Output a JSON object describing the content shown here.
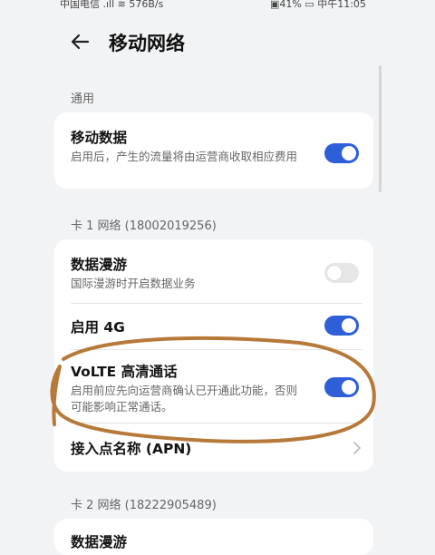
{
  "status_bar": {
    "left": "中国电信 .ıll ≋ 576B/s",
    "right": "▣41% ▭ 中午11:05"
  },
  "header": {
    "title": "移动网络"
  },
  "sections": {
    "general": "通用",
    "card1": "卡 1 网络 (18002019256)",
    "card2": "卡 2 网络 (18222905489)"
  },
  "general_card": {
    "mobile_data": {
      "title": "移动数据",
      "subtitle": "启用后，产生的流量将由运营商收取相应费用",
      "enabled": true
    }
  },
  "card1_items": {
    "roaming": {
      "title": "数据漫游",
      "subtitle": "国际漫游时开启数据业务",
      "enabled": false
    },
    "enable_4g": {
      "title": "启用 4G",
      "enabled": true
    },
    "volte": {
      "title": "VoLTE 高清通话",
      "subtitle": "启用前应先向运营商确认已开通此功能，否则可能影响正常通话。",
      "enabled": true
    },
    "apn": {
      "title": "接入点名称 (APN)"
    }
  },
  "card2_items": {
    "roaming": {
      "title": "数据漫游"
    }
  },
  "colors": {
    "accent": "#2f5fd8",
    "annotation": "#b7793a",
    "background": "#f2f3f5"
  },
  "icons": {
    "back": "back-arrow-icon",
    "chevron": "chevron-right-icon"
  }
}
